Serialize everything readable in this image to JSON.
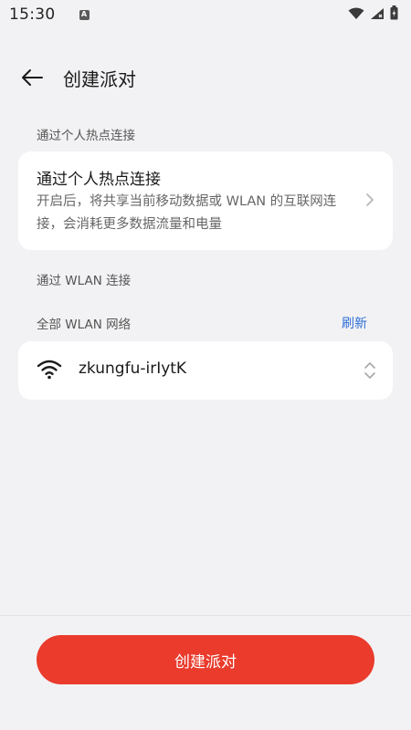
{
  "status_bar": {
    "time": "15:30",
    "notification_icon_letter": "A"
  },
  "header": {
    "title": "创建派对"
  },
  "hotspot_section": {
    "title": "通过个人热点连接",
    "card_title": "通过个人热点连接",
    "description": "开启后，将共享当前移动数据或 WLAN 的互联网连接，会消耗更多数据流量和电量"
  },
  "wlan_section": {
    "title": "通过 WLAN 连接",
    "subtitle": "全部 WLAN 网络",
    "refresh_label": "刷新",
    "selected_network": "zkungfu-irIytK"
  },
  "bottom": {
    "create_button_label": "创建派对"
  },
  "colors": {
    "background": "#f2f2f4",
    "card": "#ffffff",
    "accent_blue": "#2f6fd6",
    "primary_red": "#ea3b2c"
  },
  "icons": [
    "wifi-status-icon",
    "signal-icon",
    "battery-icon",
    "back-arrow-icon",
    "chevron-right-icon",
    "wifi-icon",
    "up-down-chevron-icon"
  ]
}
